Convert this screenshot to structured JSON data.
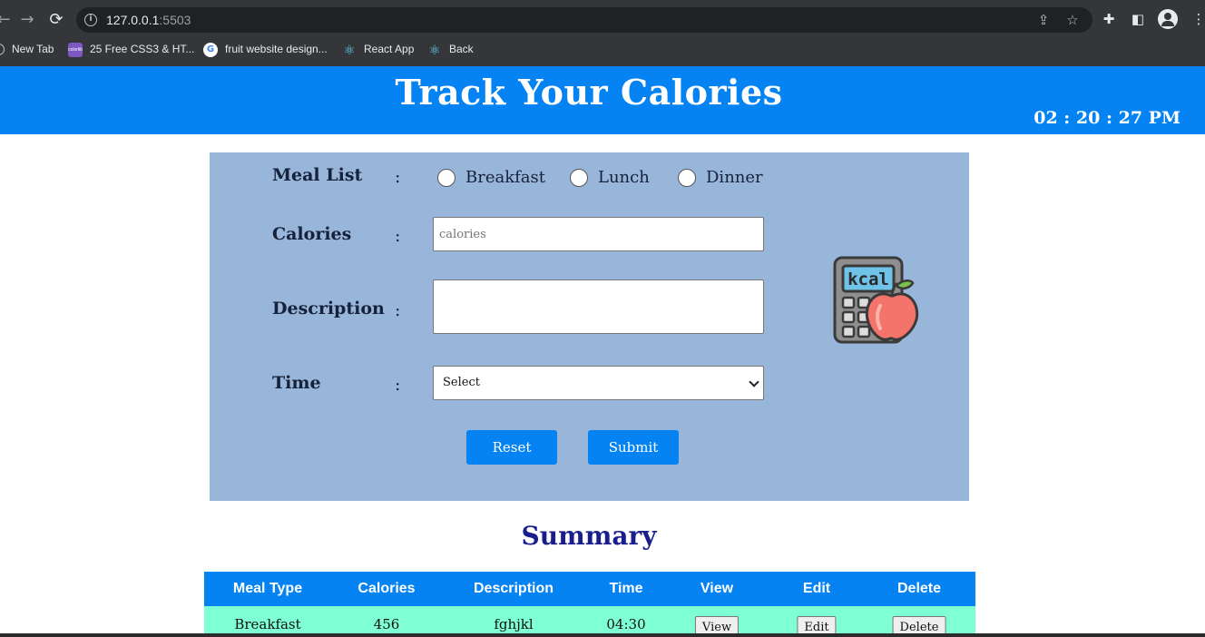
{
  "browser": {
    "url_host": "127.0.0.1",
    "url_port": ":5503",
    "bookmarks": [
      {
        "label": "New Tab",
        "icon": "globe-icon"
      },
      {
        "label": "25 Free CSS3 & HT...",
        "icon": "colorlib-icon"
      },
      {
        "label": "fruit website design...",
        "icon": "google-icon"
      },
      {
        "label": "React App",
        "icon": "react-icon"
      },
      {
        "label": "Back",
        "icon": "react-icon"
      }
    ]
  },
  "header": {
    "title": "Track Your Calories",
    "clock": "02 : 20 : 27 PM",
    "background_color": "#0583f2"
  },
  "form": {
    "panel_color": "#98b5da",
    "meal_list_label": "Meal List",
    "colon": ":",
    "meal_options": [
      "Breakfast",
      "Lunch",
      "Dinner"
    ],
    "calories_label": "Calories",
    "calories_placeholder": "calories",
    "description_label": "Description",
    "time_label": "Time",
    "time_selected": "Select",
    "reset_label": "Reset",
    "submit_label": "Submit",
    "illustration_text": "kcal"
  },
  "summary": {
    "title": "Summary",
    "columns": [
      "Meal Type",
      "Calories",
      "Description",
      "Time",
      "View",
      "Edit",
      "Delete"
    ],
    "rows": [
      {
        "meal_type": "Breakfast",
        "calories": "456",
        "description": "fghjkl",
        "time": "04:30",
        "view": "View",
        "edit": "Edit",
        "delete": "Delete"
      }
    ],
    "header_color": "#0583f2",
    "row_color": "#7fffd4"
  }
}
